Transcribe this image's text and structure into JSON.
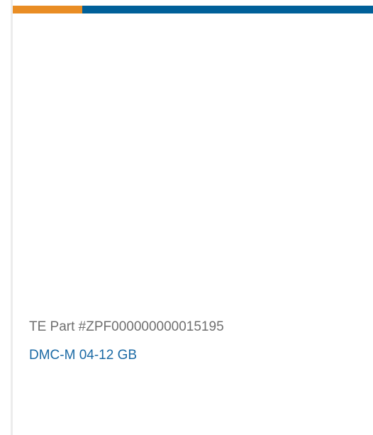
{
  "card": {
    "part_number": "TE Part #ZPF000000000015195",
    "product_name": "DMC-M 04-12 GB"
  },
  "colors": {
    "accent_orange": "#e98d24",
    "accent_blue": "#006099",
    "part_text": "#6f6f6f",
    "link_text": "#1b6aa5"
  }
}
